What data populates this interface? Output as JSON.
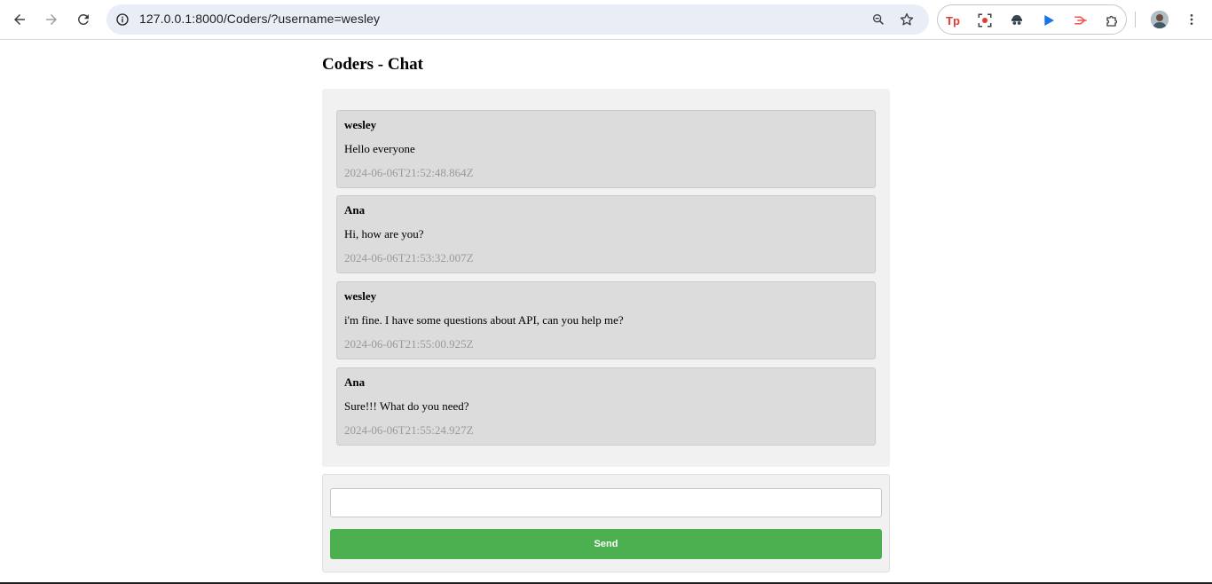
{
  "browser": {
    "url": "127.0.0.1:8000/Coders/?username=wesley",
    "nav_icons": [
      "back-icon",
      "forward-icon",
      "reload-icon"
    ],
    "extensions": [
      {
        "name": "tp-extension-icon",
        "label": "Tp",
        "color": "#e53935"
      },
      {
        "name": "screenshot-extension-icon",
        "label": "",
        "color": "#e53935"
      },
      {
        "name": "spy-extension-icon",
        "label": "",
        "color": "#37474f"
      },
      {
        "name": "play-extension-icon",
        "label": "",
        "color": "#1a73e8"
      },
      {
        "name": "arrow-extension-icon",
        "label": "",
        "color": "#ef5350"
      },
      {
        "name": "puzzle-extension-icon",
        "label": "",
        "color": "#3c4043"
      }
    ]
  },
  "page": {
    "title": "Coders - Chat"
  },
  "chat": {
    "messages": [
      {
        "user": "wesley",
        "text": "Hello everyone",
        "time": "2024-06-06T21:52:48.864Z"
      },
      {
        "user": "Ana",
        "text": "Hi, how are you?",
        "time": "2024-06-06T21:53:32.007Z"
      },
      {
        "user": "wesley",
        "text": "i'm fine. I have some questions about API, can you help me?",
        "time": "2024-06-06T21:55:00.925Z"
      },
      {
        "user": "Ana",
        "text": "Sure!!! What do you need?",
        "time": "2024-06-06T21:55:24.927Z"
      }
    ]
  },
  "composer": {
    "input_value": "",
    "input_placeholder": "",
    "send_label": "Send"
  },
  "colors": {
    "send_button": "#4caf50",
    "message_bg": "#dcdcdc",
    "panel_bg": "#f1f1f1",
    "timestamp": "#9a9a9a"
  }
}
